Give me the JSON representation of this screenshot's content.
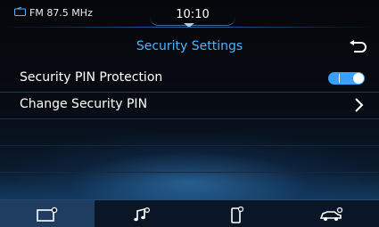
{
  "status_bar": {
    "source_label": "FM 87.5 MHz",
    "clock": "10:10"
  },
  "header": {
    "title": "Security Settings"
  },
  "settings": [
    {
      "label": "Security PIN Protection",
      "control": "toggle",
      "state": "on"
    },
    {
      "label": "Change Security PIN",
      "control": "chevron"
    }
  ],
  "bottom_nav": [
    {
      "icon": "display-settings-icon",
      "active": true
    },
    {
      "icon": "audio-settings-icon",
      "active": false
    },
    {
      "icon": "phone-settings-icon",
      "active": false
    },
    {
      "icon": "vehicle-settings-icon",
      "active": false
    }
  ],
  "colors": {
    "accent": "#4fb2ff",
    "toggle_on": "#3aa0ff",
    "text": "#ffffff"
  }
}
